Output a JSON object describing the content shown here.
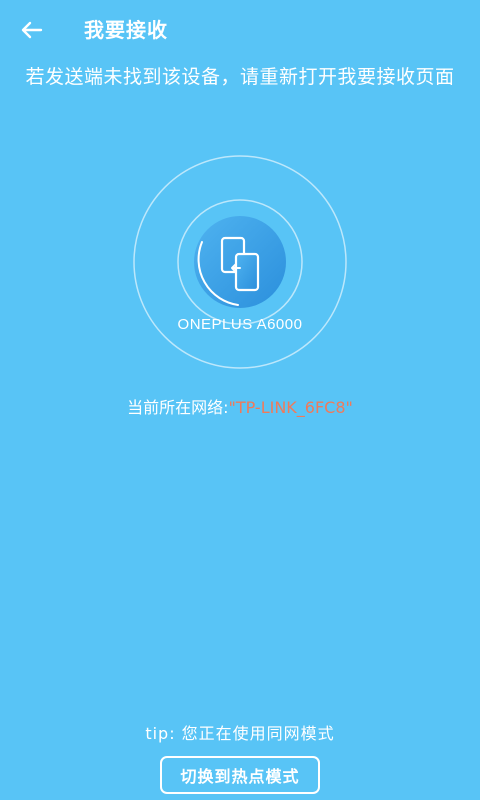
{
  "header": {
    "back_icon": "arrow-left-icon",
    "title": "我要接收"
  },
  "hint": "若发送端未找到该设备，请重新打开我要接收页面",
  "device": {
    "icon": "phone-transfer-icon",
    "name": "ONEPLUS A6000"
  },
  "network": {
    "label": "当前所在网络:",
    "ssid": "\"TP-LINK_6FC8\""
  },
  "footer": {
    "tip": "tip:  您正在使用同网模式",
    "switch_button_label": "切换到热点模式"
  },
  "colors": {
    "background": "#58c4f6",
    "ssid_highlight": "#f07a5a",
    "device_circle": "#3aa0e6"
  }
}
